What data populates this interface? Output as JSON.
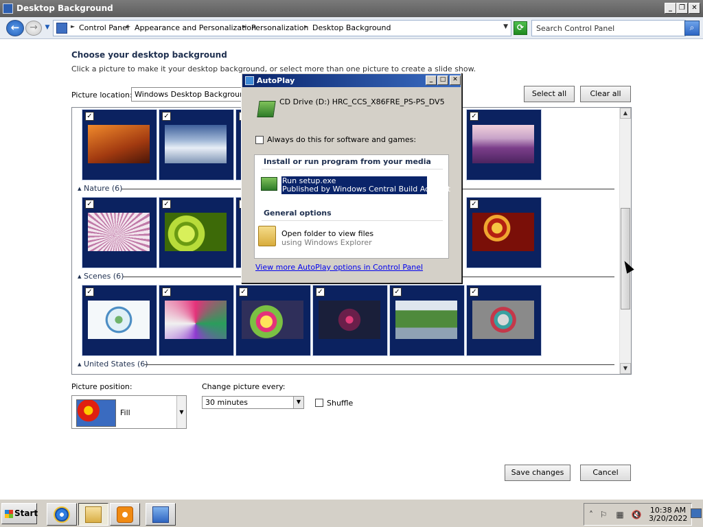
{
  "window": {
    "title": "Desktop Background"
  },
  "address_bar": {
    "breadcrumbs": [
      "Control Panel",
      "Appearance and Personalization",
      "Personalization",
      "Desktop Background"
    ],
    "search_placeholder": "Search Control Panel"
  },
  "content": {
    "heading": "Choose your desktop background",
    "subtext": "Click a picture to make it your desktop background, or select more than one picture to create a slide show.",
    "picture_location_label": "Picture location:",
    "picture_location_value": "Windows Desktop Backgrounds",
    "select_all": "Select all",
    "clear_all": "Clear all",
    "groups": [
      {
        "label": "Nature (6)"
      },
      {
        "label": "Scenes (6)"
      },
      {
        "label": "United States (6)"
      }
    ],
    "picture_position_label": "Picture position:",
    "picture_position_value": "Fill",
    "change_every_label": "Change picture every:",
    "change_every_value": "30 minutes",
    "shuffle_label": "Shuffle",
    "save_changes": "Save changes",
    "cancel": "Cancel"
  },
  "autoplay": {
    "title": "AutoPlay",
    "drive": "CD Drive (D:) HRC_CCS_X86FRE_PS-PS_DV5",
    "always_label": "Always do this for software and games:",
    "install_header": "Install or run program from your media",
    "run_line1": "Run setup.exe",
    "run_line2": "Published by Windows Central Build Account",
    "general_header": "General options",
    "open_folder": "Open folder to view files",
    "open_folder_sub": "using Windows Explorer",
    "more_link": "View more AutoPlay options in Control Panel"
  },
  "taskbar": {
    "start_label": "Start",
    "time": "10:38 AM",
    "date": "3/20/2022"
  }
}
